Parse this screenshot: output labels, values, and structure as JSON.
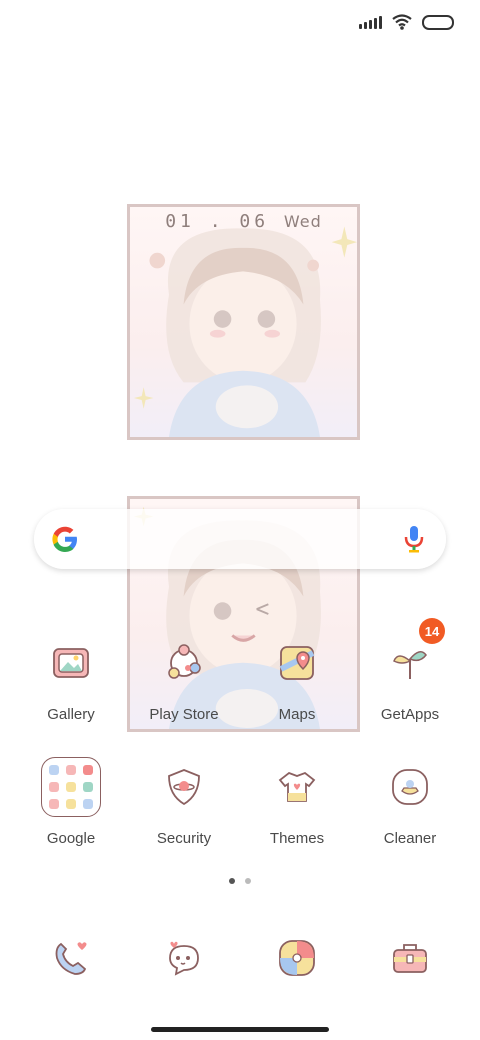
{
  "status": {
    "icons": [
      "signal-icon",
      "wifi-icon",
      "battery-icon"
    ]
  },
  "widget": {
    "date": "01 . 06",
    "day": "Wed"
  },
  "search": {
    "logo": "G",
    "icons": [
      "google-logo",
      "mic-icon"
    ]
  },
  "apps": [
    {
      "label": "Gallery",
      "icon": "gallery-icon"
    },
    {
      "label": "Play Store",
      "icon": "play-store-icon"
    },
    {
      "label": "Maps",
      "icon": "maps-icon"
    },
    {
      "label": "GetApps",
      "icon": "getapps-icon",
      "badge": "14"
    },
    {
      "label": "Google",
      "icon": "google-folder-icon"
    },
    {
      "label": "Security",
      "icon": "security-icon"
    },
    {
      "label": "Themes",
      "icon": "themes-icon"
    },
    {
      "label": "Cleaner",
      "icon": "cleaner-icon"
    }
  ],
  "dock": [
    {
      "icon": "phone-icon"
    },
    {
      "icon": "messages-icon"
    },
    {
      "icon": "browser-icon"
    },
    {
      "icon": "toolbox-icon"
    }
  ],
  "colors": {
    "badge": "#f15b24",
    "outline": "#8b6060",
    "widget_border": "#d9c6c4"
  }
}
